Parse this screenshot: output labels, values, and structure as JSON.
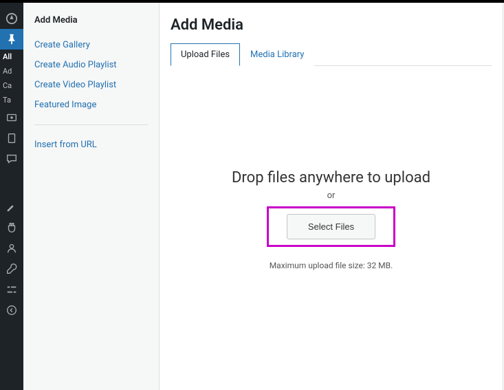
{
  "admin_menu": {
    "items": [
      "All",
      "Ad",
      "Ca",
      "Ta"
    ]
  },
  "sidebar": {
    "heading": "Add Media",
    "items": [
      "Create Gallery",
      "Create Audio Playlist",
      "Create Video Playlist",
      "Featured Image"
    ],
    "insert_url": "Insert from URL"
  },
  "main": {
    "title": "Add Media",
    "tabs": {
      "upload": "Upload Files",
      "library": "Media Library"
    },
    "upload": {
      "drop_text": "Drop files anywhere to upload",
      "or_text": "or",
      "select_button": "Select Files",
      "max_size": "Maximum upload file size: 32 MB."
    }
  }
}
